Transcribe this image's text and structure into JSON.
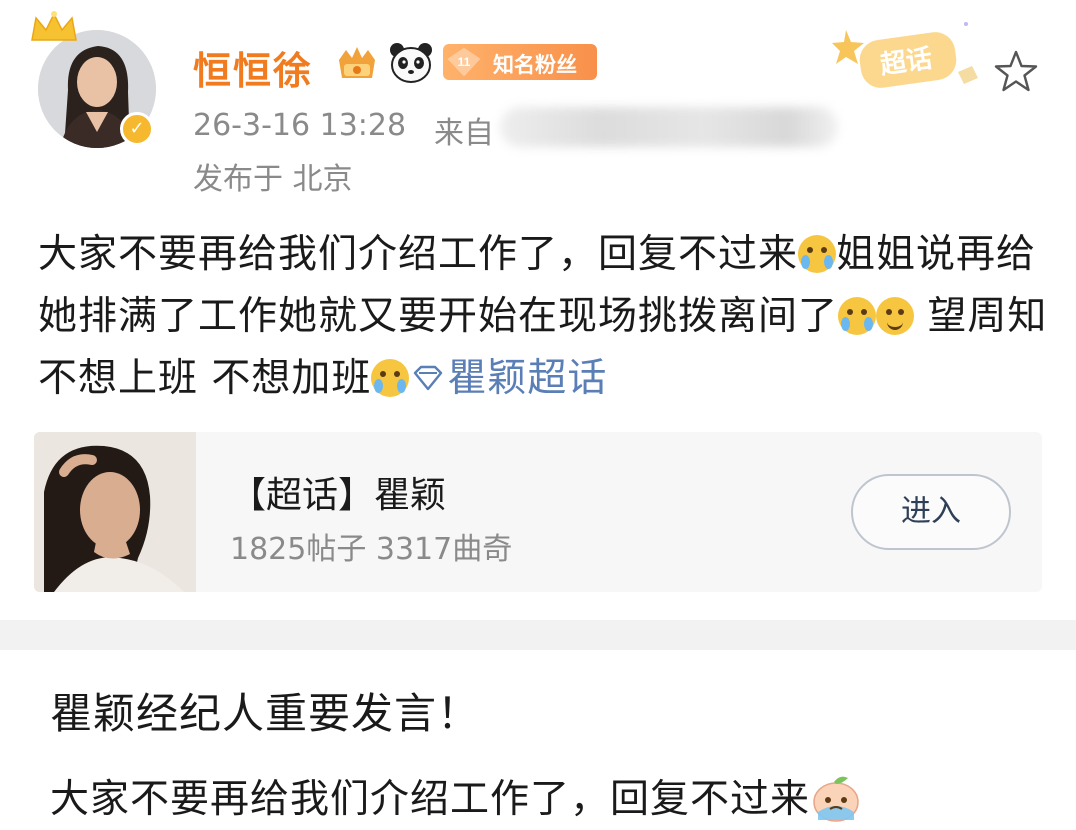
{
  "post": {
    "username": "恒恒徐",
    "fan_badge": {
      "level": "11",
      "label": "知名粉丝"
    },
    "timestamp": "26-3-16 13:28",
    "source_prefix": "来自",
    "location": "发布于 北京",
    "super_topic_badge": "超话",
    "body": {
      "text1": "大家不要再给我们介绍工作了，回复不过来",
      "text2": "姐姐说再给她排满了工作她就又要开始在现场挑拨离间了",
      "text3": " 望周知 不想上班 不想加班",
      "topic_link": "瞿颖超话"
    },
    "topic_card": {
      "title": "【超话】瞿颖",
      "stats": "1825帖子 3317曲奇",
      "enter_label": "进入"
    }
  },
  "article": {
    "headline": "瞿颖经纪人重要发言！",
    "body": "大家不要再给我们介绍工作了，回复不过来"
  },
  "colors": {
    "username": "#f07c1f",
    "link": "#5a7eb6",
    "meta": "#8a8a8a"
  }
}
